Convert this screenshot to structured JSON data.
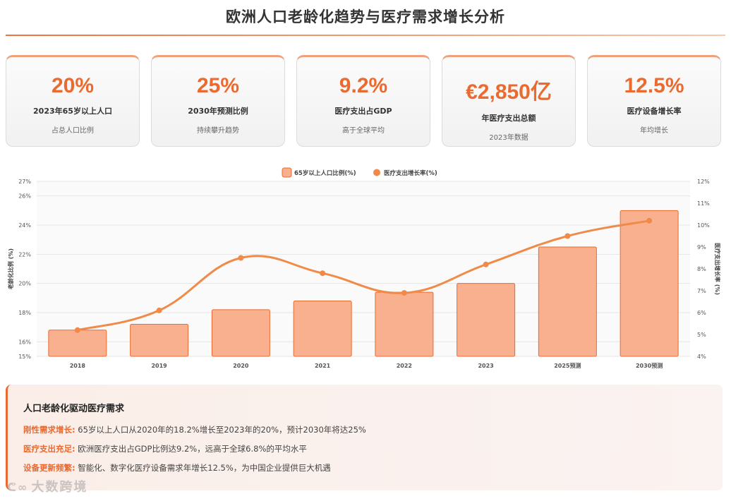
{
  "page": {
    "title": "欧洲人口老龄化趋势与医疗需求增长分析"
  },
  "kpis": [
    {
      "value": "20%",
      "label": "2023年65岁以上人口",
      "sub": "占总人口比例"
    },
    {
      "value": "25%",
      "label": "2030年预测比例",
      "sub": "持续攀升趋势"
    },
    {
      "value": "9.2%",
      "label": "医疗支出占GDP",
      "sub": "高于全球平均"
    },
    {
      "value": "€2,850亿",
      "label": "年医疗支出总额",
      "sub": "2023年数据"
    },
    {
      "value": "12.5%",
      "label": "医疗设备增长率",
      "sub": "年均增长"
    }
  ],
  "chart_data": {
    "type": "bar",
    "categories": [
      "2018",
      "2019",
      "2020",
      "2021",
      "2022",
      "2023",
      "2025预测",
      "2030预测"
    ],
    "series": [
      {
        "name": "65岁以上人口比例(%)",
        "type": "bar",
        "axis": "left",
        "values": [
          16.8,
          17.2,
          18.2,
          18.8,
          19.4,
          20.0,
          22.5,
          25.0
        ]
      },
      {
        "name": "医疗支出增长率(%)",
        "type": "line",
        "axis": "right",
        "values": [
          5.2,
          6.1,
          8.5,
          7.8,
          6.9,
          8.2,
          9.5,
          10.2
        ]
      }
    ],
    "ylabel": "老龄化比例 (%)",
    "y2label": "医疗支出增长率 (%)",
    "ylim": [
      15,
      27
    ],
    "y2lim": [
      4,
      12
    ],
    "yticks": [
      15,
      16,
      18,
      20,
      22,
      24,
      26,
      27
    ],
    "y2ticks": [
      4,
      5,
      6,
      7,
      8,
      9,
      10,
      11,
      12
    ],
    "legend": "top-center",
    "grid": true,
    "colors": {
      "bar_fill": "#f9b08f",
      "bar_stroke": "#ea6a2f",
      "line": "#f08a48"
    }
  },
  "insight": {
    "title": "人口老龄化驱动医疗需求",
    "rows": [
      {
        "key": "刚性需求增长:",
        "text": "65岁以上人口从2020年的18.2%增长至2023年的20%，预计2030年将达25%"
      },
      {
        "key": "医疗支出充足:",
        "text": "欧洲医疗支出占GDP比例达9.2%，远高于全球6.8%的平均水平"
      },
      {
        "key": "设备更新频繁:",
        "text": "智能化、数字化医疗设备需求年增长12.5%，为中国企业提供巨大机遇"
      }
    ]
  },
  "watermark": {
    "text": "大数跨境"
  }
}
